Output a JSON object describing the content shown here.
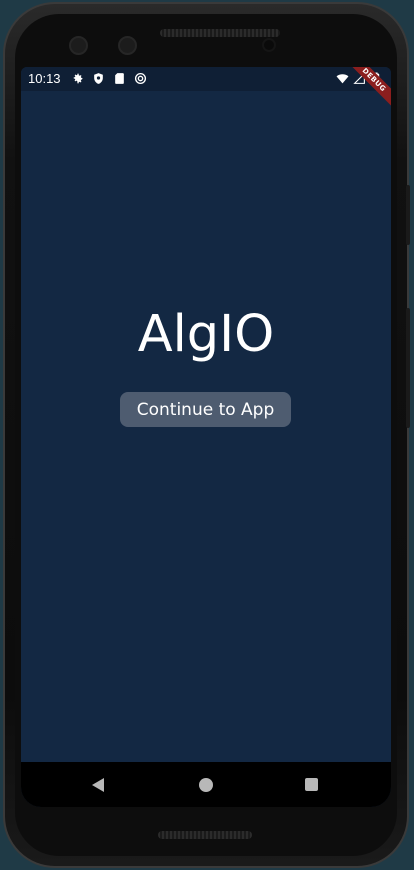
{
  "status_bar": {
    "time": "10:13",
    "left_icons": [
      "settings-icon",
      "shield-icon",
      "sd-card-icon",
      "sync-icon"
    ],
    "right_icons": [
      "wifi-icon",
      "signal-icon",
      "battery-icon"
    ]
  },
  "debug_banner": {
    "label": "DEBUG"
  },
  "app": {
    "title": "AlgIO",
    "continue_label": "Continue to App"
  },
  "nav_bar": {
    "icons": [
      "back-icon",
      "home-icon",
      "recents-icon"
    ]
  },
  "colors": {
    "screen_background": "#132843",
    "button_background": "#4e5c70",
    "debug_banner": "#8b1e1e"
  }
}
